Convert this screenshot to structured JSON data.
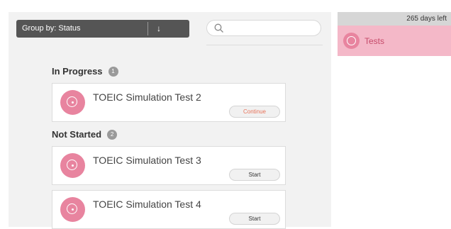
{
  "toolbar": {
    "group_by_label": "Group by: Status",
    "sort_icon": "down-arrow-icon",
    "search_icon": "search-icon",
    "search_value": ""
  },
  "sections": [
    {
      "title": "In Progress",
      "count": "1",
      "items": [
        {
          "title": "TOEIC Simulation Test 2",
          "action": "Continue"
        }
      ]
    },
    {
      "title": "Not Started",
      "count": "2",
      "items": [
        {
          "title": "TOEIC Simulation Test 3",
          "action": "Start"
        },
        {
          "title": "TOEIC Simulation Test 4",
          "action": "Start"
        }
      ]
    }
  ],
  "sidebar": {
    "days_left": "265 days left",
    "tests_label": "Tests"
  },
  "colors": {
    "accent_pink": "#e8849f",
    "sidebar_highlight": "#f4b8c8",
    "continue_text": "#e8735a"
  }
}
